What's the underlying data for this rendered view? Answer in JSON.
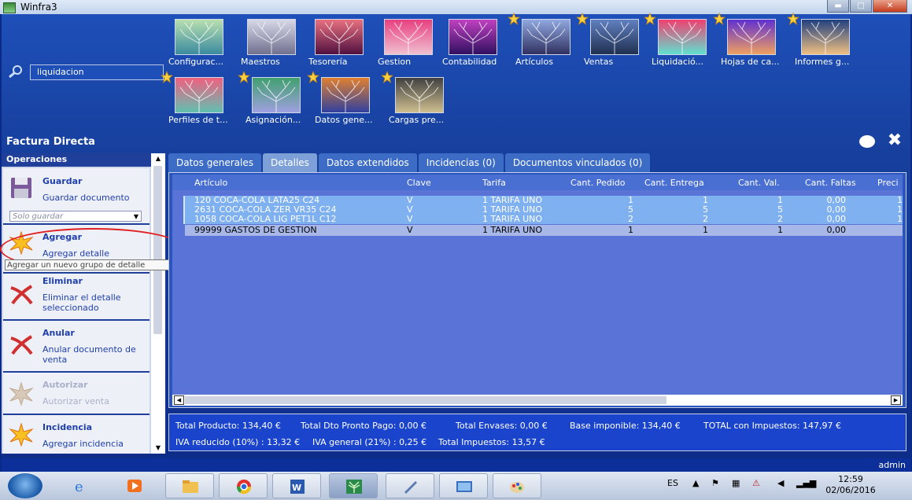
{
  "window": {
    "title": "Winfra3"
  },
  "search": {
    "value": "liquidacion"
  },
  "modules_row1": [
    {
      "label": "Configurac...",
      "starred": false,
      "colors": [
        "#b8e0b0",
        "#3a8aa0"
      ]
    },
    {
      "label": "Maestros",
      "starred": false,
      "colors": [
        "#d8d8e8",
        "#707090"
      ]
    },
    {
      "label": "Tesorería",
      "starred": false,
      "colors": [
        "#e87080",
        "#501040"
      ]
    },
    {
      "label": "Gestion",
      "starred": false,
      "colors": [
        "#e84080",
        "#f0c0d0"
      ]
    },
    {
      "label": "Contabilidad",
      "starred": false,
      "colors": [
        "#c040c0",
        "#301060"
      ]
    },
    {
      "label": "Artículos",
      "starred": true,
      "colors": [
        "#90a8e0",
        "#303060"
      ]
    },
    {
      "label": "Ventas",
      "starred": true,
      "colors": [
        "#6080c0",
        "#203050"
      ]
    },
    {
      "label": "Liquidació...",
      "starred": true,
      "colors": [
        "#f04070",
        "#60e0d0"
      ]
    },
    {
      "label": "Hojas de ca...",
      "starred": true,
      "colors": [
        "#6030d0",
        "#f0a060"
      ]
    },
    {
      "label": "Informes g...",
      "starred": true,
      "colors": [
        "#204080",
        "#f0c080"
      ]
    }
  ],
  "modules_row2": [
    {
      "label": "Perfiles de t...",
      "starred": true,
      "colors": [
        "#f06080",
        "#60c0b0"
      ]
    },
    {
      "label": "Asignación...",
      "starred": true,
      "colors": [
        "#40a070",
        "#a0a0e0"
      ]
    },
    {
      "label": "Datos gene...",
      "starred": true,
      "colors": [
        "#e08030",
        "#3040a0"
      ]
    },
    {
      "label": "Cargas pre...",
      "starred": true,
      "colors": [
        "#404040",
        "#d0c090"
      ]
    }
  ],
  "section_title": "Factura Directa",
  "operations": {
    "header": "Operaciones",
    "save": {
      "title": "Guardar",
      "sub": "Guardar documento",
      "select_value": "Solo guardar"
    },
    "add": {
      "title": "Agregar",
      "sub": "Agregar detalle"
    },
    "delete": {
      "title": "Eliminar",
      "sub": "Eliminar el detalle seleccionado"
    },
    "cancel": {
      "title": "Anular",
      "sub": "Anular documento de venta"
    },
    "authorize": {
      "title": "Autorizar",
      "sub": "Autorizar venta"
    },
    "incident": {
      "title": "Incidencia",
      "sub": "Agregar incidencia"
    },
    "tooltip": "Agregar un nuevo grupo de detalle"
  },
  "tabs": [
    "Datos generales",
    "Detalles",
    "Datos extendidos",
    "Incidencias (0)",
    "Documentos vinculados (0)"
  ],
  "active_tab": 1,
  "grid": {
    "columns": [
      "Artículo",
      "Clave",
      "Tarifa",
      "Cant. Pedido",
      "Cant. Entrega",
      "Cant. Val.",
      "Cant. Faltas",
      "Preci"
    ],
    "rows": [
      {
        "articulo": "120 COCA-COLA LATA25 C24",
        "clave": "V",
        "tarifa": "1 TARIFA UNO",
        "pedido": "1",
        "entrega": "1",
        "val": "1",
        "faltas": "0,00",
        "precio": "1"
      },
      {
        "articulo": "2631 COCA-COLA ZER VR35 C24",
        "clave": "V",
        "tarifa": "1 TARIFA UNO",
        "pedido": "5",
        "entrega": "5",
        "val": "5",
        "faltas": "0,00",
        "precio": "1"
      },
      {
        "articulo": "1058 COCA-COLA LIG PET1L C12",
        "clave": "V",
        "tarifa": "1 TARIFA UNO",
        "pedido": "2",
        "entrega": "2",
        "val": "2",
        "faltas": "0,00",
        "precio": "1"
      },
      {
        "articulo": "99999 GASTOS DE GESTION",
        "clave": "V",
        "tarifa": "1 TARIFA UNO",
        "pedido": "1",
        "entrega": "1",
        "val": "1",
        "faltas": "0,00",
        "precio": ""
      }
    ]
  },
  "totals": {
    "line1": [
      "Total Producto: 134,40 €",
      "Total Dto Pronto Pago: 0,00 €",
      "Total Envases: 0,00 €",
      "Base imponible: 134,40 €",
      "TOTAL con Impuestos: 147,97 €"
    ],
    "line2": [
      "IVA reducido (10%) : 13,32 €",
      "IVA general (21%) : 0,25 €",
      "Total Impuestos: 13,57 €"
    ]
  },
  "status": {
    "user": "admin"
  },
  "taskbar": {
    "lang": "ES",
    "time": "12:59",
    "date": "02/06/2016"
  },
  "colors": {
    "accent": "#1f3faa",
    "grid_row": "#7fb0f0",
    "grid_selected": "#a7b8e8",
    "annotation": "#e02020"
  }
}
